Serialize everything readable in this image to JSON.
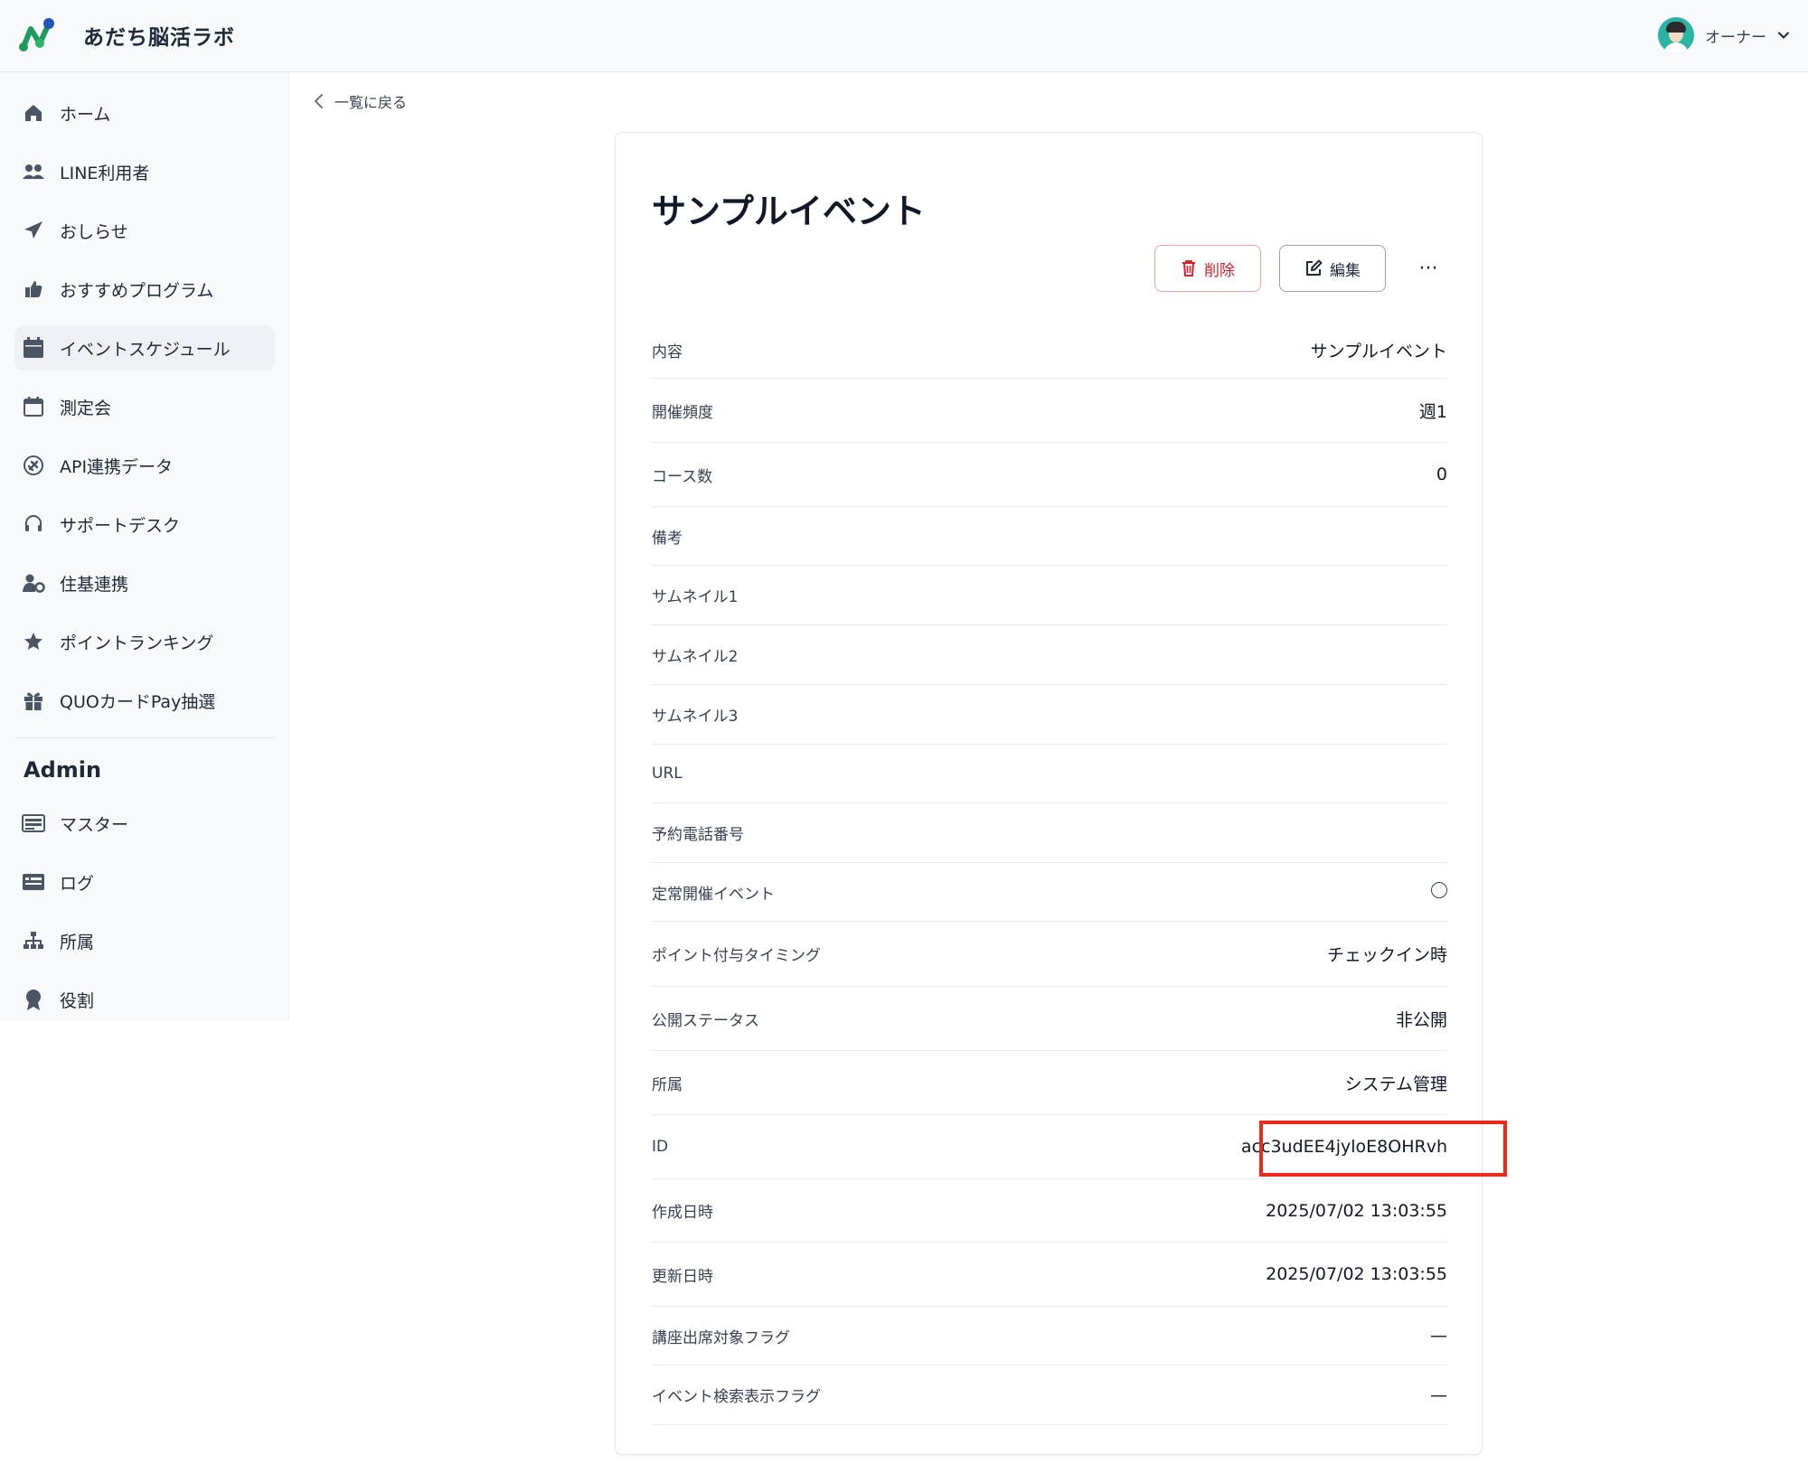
{
  "app": {
    "title": "あだち脳活ラボ"
  },
  "user": {
    "name": "オーナー"
  },
  "sidebar": {
    "items": [
      {
        "label": "ホーム",
        "icon": "home-icon"
      },
      {
        "label": "LINE利用者",
        "icon": "users-icon"
      },
      {
        "label": "おしらせ",
        "icon": "paper-plane-icon"
      },
      {
        "label": "おすすめプログラム",
        "icon": "thumbs-up-icon"
      },
      {
        "label": "イベントスケジュール",
        "icon": "calendar-filled-icon",
        "active": true
      },
      {
        "label": "測定会",
        "icon": "calendar-outline-icon"
      },
      {
        "label": "API連携データ",
        "icon": "plug-icon"
      },
      {
        "label": "サポートデスク",
        "icon": "headset-icon"
      },
      {
        "label": "住基連携",
        "icon": "user-gear-icon"
      },
      {
        "label": "ポイントランキング",
        "icon": "star-icon"
      },
      {
        "label": "QUOカードPay抽選",
        "icon": "gift-icon"
      }
    ],
    "admin_heading": "Admin",
    "admin_items": [
      {
        "label": "マスター",
        "icon": "database-icon"
      },
      {
        "label": "ログ",
        "icon": "log-icon"
      },
      {
        "label": "所属",
        "icon": "org-chart-icon"
      },
      {
        "label": "役割",
        "icon": "award-icon"
      }
    ]
  },
  "back_link": {
    "label": "一覧に戻る"
  },
  "detail": {
    "title": "サンプルイベント",
    "delete_label": "削除",
    "edit_label": "編集",
    "more_label": "···",
    "rows": [
      {
        "label": "内容",
        "value": "サンプルイベント"
      },
      {
        "label": "開催頻度",
        "value": "週1"
      },
      {
        "label": "コース数",
        "value": "0"
      },
      {
        "label": "備考",
        "value": ""
      },
      {
        "label": "サムネイル1",
        "value": ""
      },
      {
        "label": "サムネイル2",
        "value": ""
      },
      {
        "label": "サムネイル3",
        "value": ""
      },
      {
        "label": "URL",
        "value": ""
      },
      {
        "label": "予約電話番号",
        "value": ""
      },
      {
        "label": "定常開催イベント",
        "value": "◯"
      },
      {
        "label": "ポイント付与タイミング",
        "value": "チェックイン時"
      },
      {
        "label": "公開ステータス",
        "value": "非公開"
      },
      {
        "label": "所属",
        "value": "システム管理"
      },
      {
        "label": "ID",
        "value": "acc3udEE4jyloE8OHRvh",
        "highlighted": true
      },
      {
        "label": "作成日時",
        "value": "2025/07/02 13:03:55"
      },
      {
        "label": "更新日時",
        "value": "2025/07/02 13:03:55"
      },
      {
        "label": "講座出席対象フラグ",
        "value": "—"
      },
      {
        "label": "イベント検索表示フラグ",
        "value": "—"
      }
    ]
  },
  "colors": {
    "accent_red": "#d1242f",
    "highlight_box": "#ee2b1b",
    "logo_green": "#1f9a5b",
    "logo_blue": "#2156b8"
  }
}
